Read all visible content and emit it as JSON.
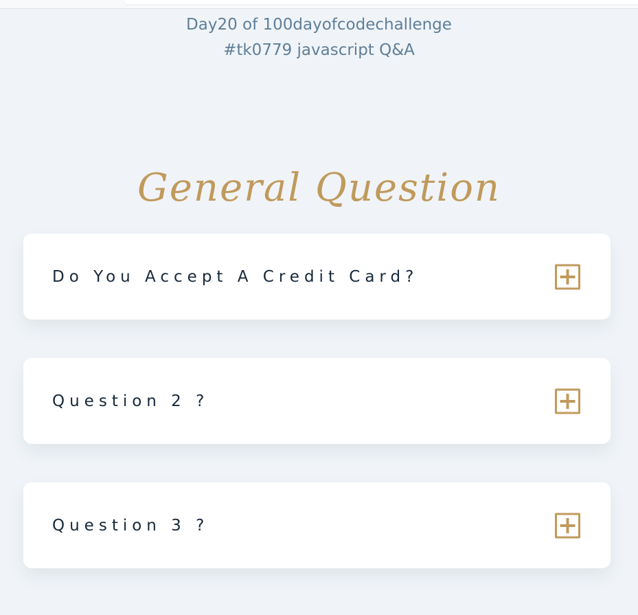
{
  "header": {
    "line1": "Day20 of 100dayofcodechallenge",
    "line2": "#tk0779 javascript Q&A"
  },
  "section": {
    "title": "General Question"
  },
  "faq": {
    "items": [
      {
        "question": "Do You Accept A Credit Card?",
        "icon": "plus-square-icon"
      },
      {
        "question": "Question 2 ?",
        "icon": "plus-square-icon"
      },
      {
        "question": "Question 3 ?",
        "icon": "plus-square-icon"
      }
    ]
  },
  "colors": {
    "background": "#f0f4f8",
    "header_text": "#5f7e98",
    "accent": "#c09a5c",
    "question_text": "#17283a",
    "card": "#ffffff"
  }
}
